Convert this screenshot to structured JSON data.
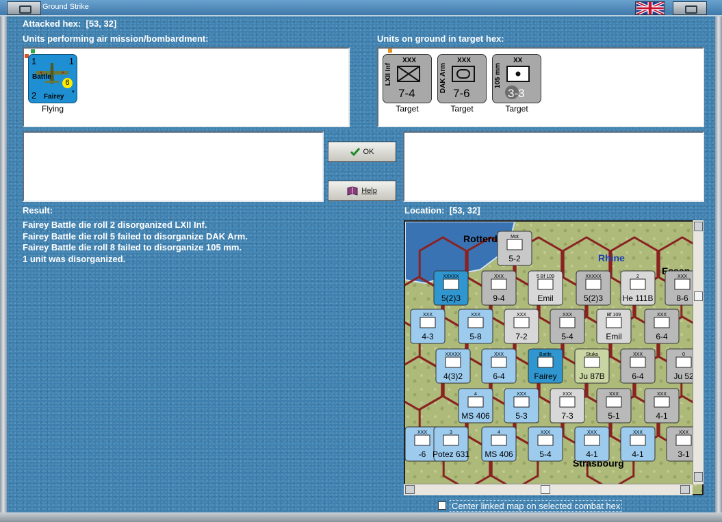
{
  "window": {
    "title": "Ground Strike",
    "flag_icon": "union-jack-flag-icon"
  },
  "attacked_hex": {
    "label": "Attacked hex:",
    "value": "[53, 32]"
  },
  "air_units": {
    "heading": "Units performing air mission/bombardment:",
    "units": [
      {
        "name_top": "Battle",
        "name_bottom": "Fairey",
        "top_left": "1",
        "top_right": "1",
        "bottom_left": "2",
        "badge": "6",
        "star": "*",
        "status": "Flying",
        "color": "#1e8fd2"
      }
    ]
  },
  "ground_units": {
    "heading": "Units on ground in target hex:",
    "units": [
      {
        "side_label": "LXII Inf",
        "size": "XXX",
        "strength": "7-4",
        "status": "Target",
        "symbol": "infantry",
        "color": "#a8a8a8"
      },
      {
        "side_label": "DAK Arm",
        "size": "XXX",
        "strength": "7-6",
        "status": "Target",
        "symbol": "armor",
        "color": "#a8a8a8"
      },
      {
        "side_label": "105 mm",
        "size": "XX",
        "strength": "3-3",
        "status": "Target",
        "symbol": "artillery",
        "color": "#a8a8a8"
      }
    ]
  },
  "buttons": {
    "ok": "OK",
    "help": "Help"
  },
  "result": {
    "heading": "Result:",
    "lines": [
      "Fairey Battle die roll 2 disorganized LXII Inf.",
      "Fairey Battle die roll 5 failed to disorganize DAK Arm.",
      "Fairey Battle die roll 8 failed to disorganize 105 mm.",
      "1 unit was disorganized."
    ]
  },
  "location": {
    "label": "Location:",
    "value": "[53, 32]"
  },
  "map": {
    "place_names": [
      "Rotterdam",
      "Rhine",
      "Essen",
      "Strasbourg"
    ],
    "counters": [
      {
        "text": "5-2",
        "label": "Mot"
      },
      {
        "text": "5(2)3",
        "label": "XXXXX"
      },
      {
        "text": "9-4",
        "label": "XXX"
      },
      {
        "text": "Emil",
        "label": "5 Bf 109"
      },
      {
        "text": "5(2)3",
        "label": "XXXXX"
      },
      {
        "text": "He 111B",
        "label": "2"
      },
      {
        "text": "8-6",
        "label": "XXX"
      },
      {
        "text": "4-3",
        "label": "XXX"
      },
      {
        "text": "5-8",
        "label": "XXX"
      },
      {
        "text": "7-2",
        "label": "XXX"
      },
      {
        "text": "5-4",
        "label": "XXX"
      },
      {
        "text": "Emil",
        "label": "Bf 109"
      },
      {
        "text": "6-4",
        "label": "XXX"
      },
      {
        "text": "4(3)2",
        "label": "XXXXX"
      },
      {
        "text": "6-4",
        "label": "XXX"
      },
      {
        "text": "Fairey",
        "label": "Battle"
      },
      {
        "text": "Ju 87B",
        "label": "Stuka"
      },
      {
        "text": "6-4",
        "label": "XXX"
      },
      {
        "text": "Ju 52",
        "label": "0"
      },
      {
        "text": "MS 406",
        "label": "4"
      },
      {
        "text": "5-3",
        "label": "XXX"
      },
      {
        "text": "7-3",
        "label": "XXX"
      },
      {
        "text": "5-1",
        "label": "XXX"
      },
      {
        "text": "4-1",
        "label": "XXX"
      },
      {
        "text": "-6",
        "label": "XXX"
      },
      {
        "text": "Potez 631",
        "label": "3"
      },
      {
        "text": "MS 406",
        "label": "4"
      },
      {
        "text": "5-4",
        "label": "XXX"
      },
      {
        "text": "4-1",
        "label": "XXX"
      },
      {
        "text": "4-1",
        "label": "XXX"
      },
      {
        "text": "3-1",
        "label": "XXX"
      }
    ]
  },
  "footer": {
    "center_checkbox_label": "Center linked map on selected combat hex",
    "checked": false
  }
}
